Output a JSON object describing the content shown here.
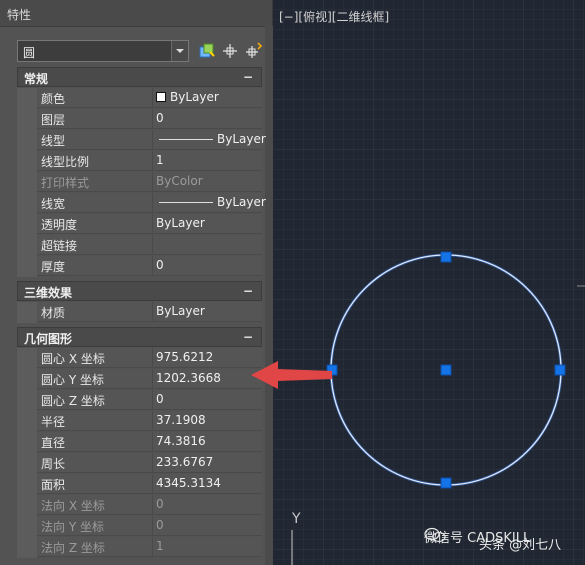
{
  "palette": {
    "title": "特性",
    "object_type": "圆",
    "sections": {
      "general": {
        "name": "常规",
        "toggle": "−",
        "rows": [
          {
            "label": "颜色",
            "value": "ByLayer"
          },
          {
            "label": "图层",
            "value": "0"
          },
          {
            "label": "线型",
            "value": "ByLayer"
          },
          {
            "label": "线型比例",
            "value": "1"
          },
          {
            "label": "打印样式",
            "value": "ByColor"
          },
          {
            "label": "线宽",
            "value": "ByLayer"
          },
          {
            "label": "透明度",
            "value": "ByLayer"
          },
          {
            "label": "超链接",
            "value": ""
          },
          {
            "label": "厚度",
            "value": "0"
          }
        ]
      },
      "three_d": {
        "name": "三维效果",
        "toggle": "−",
        "rows": [
          {
            "label": "材质",
            "value": "ByLayer"
          }
        ]
      },
      "geometry": {
        "name": "几何图形",
        "toggle": "−",
        "rows": [
          {
            "label": "圆心 X 坐标",
            "value": "975.6212"
          },
          {
            "label": "圆心 Y 坐标",
            "value": "1202.3668"
          },
          {
            "label": "圆心 Z 坐标",
            "value": "0"
          },
          {
            "label": "半径",
            "value": "37.1908"
          },
          {
            "label": "直径",
            "value": "74.3816"
          },
          {
            "label": "周长",
            "value": "233.6767"
          },
          {
            "label": "面积",
            "value": "4345.3134"
          },
          {
            "label": "法向 X 坐标",
            "value": "0"
          },
          {
            "label": "法向 Y 坐标",
            "value": "0"
          },
          {
            "label": "法向 Z 坐标",
            "value": "1"
          }
        ]
      }
    },
    "tool_icons": [
      "quick-select-icon",
      "select-objects-icon",
      "toggle-pickadd-icon"
    ],
    "swatch_color": "#ffffff"
  },
  "viewport": {
    "label": "[−][俯视][二维线框]",
    "ucs_axis": "Y",
    "grip_color": "#1473e6",
    "circle_color": "#dfe9ff",
    "arrow_color": "#e04646"
  },
  "watermark": {
    "text": "微信号 CADSKILL",
    "author": "头条 @刘七八"
  }
}
